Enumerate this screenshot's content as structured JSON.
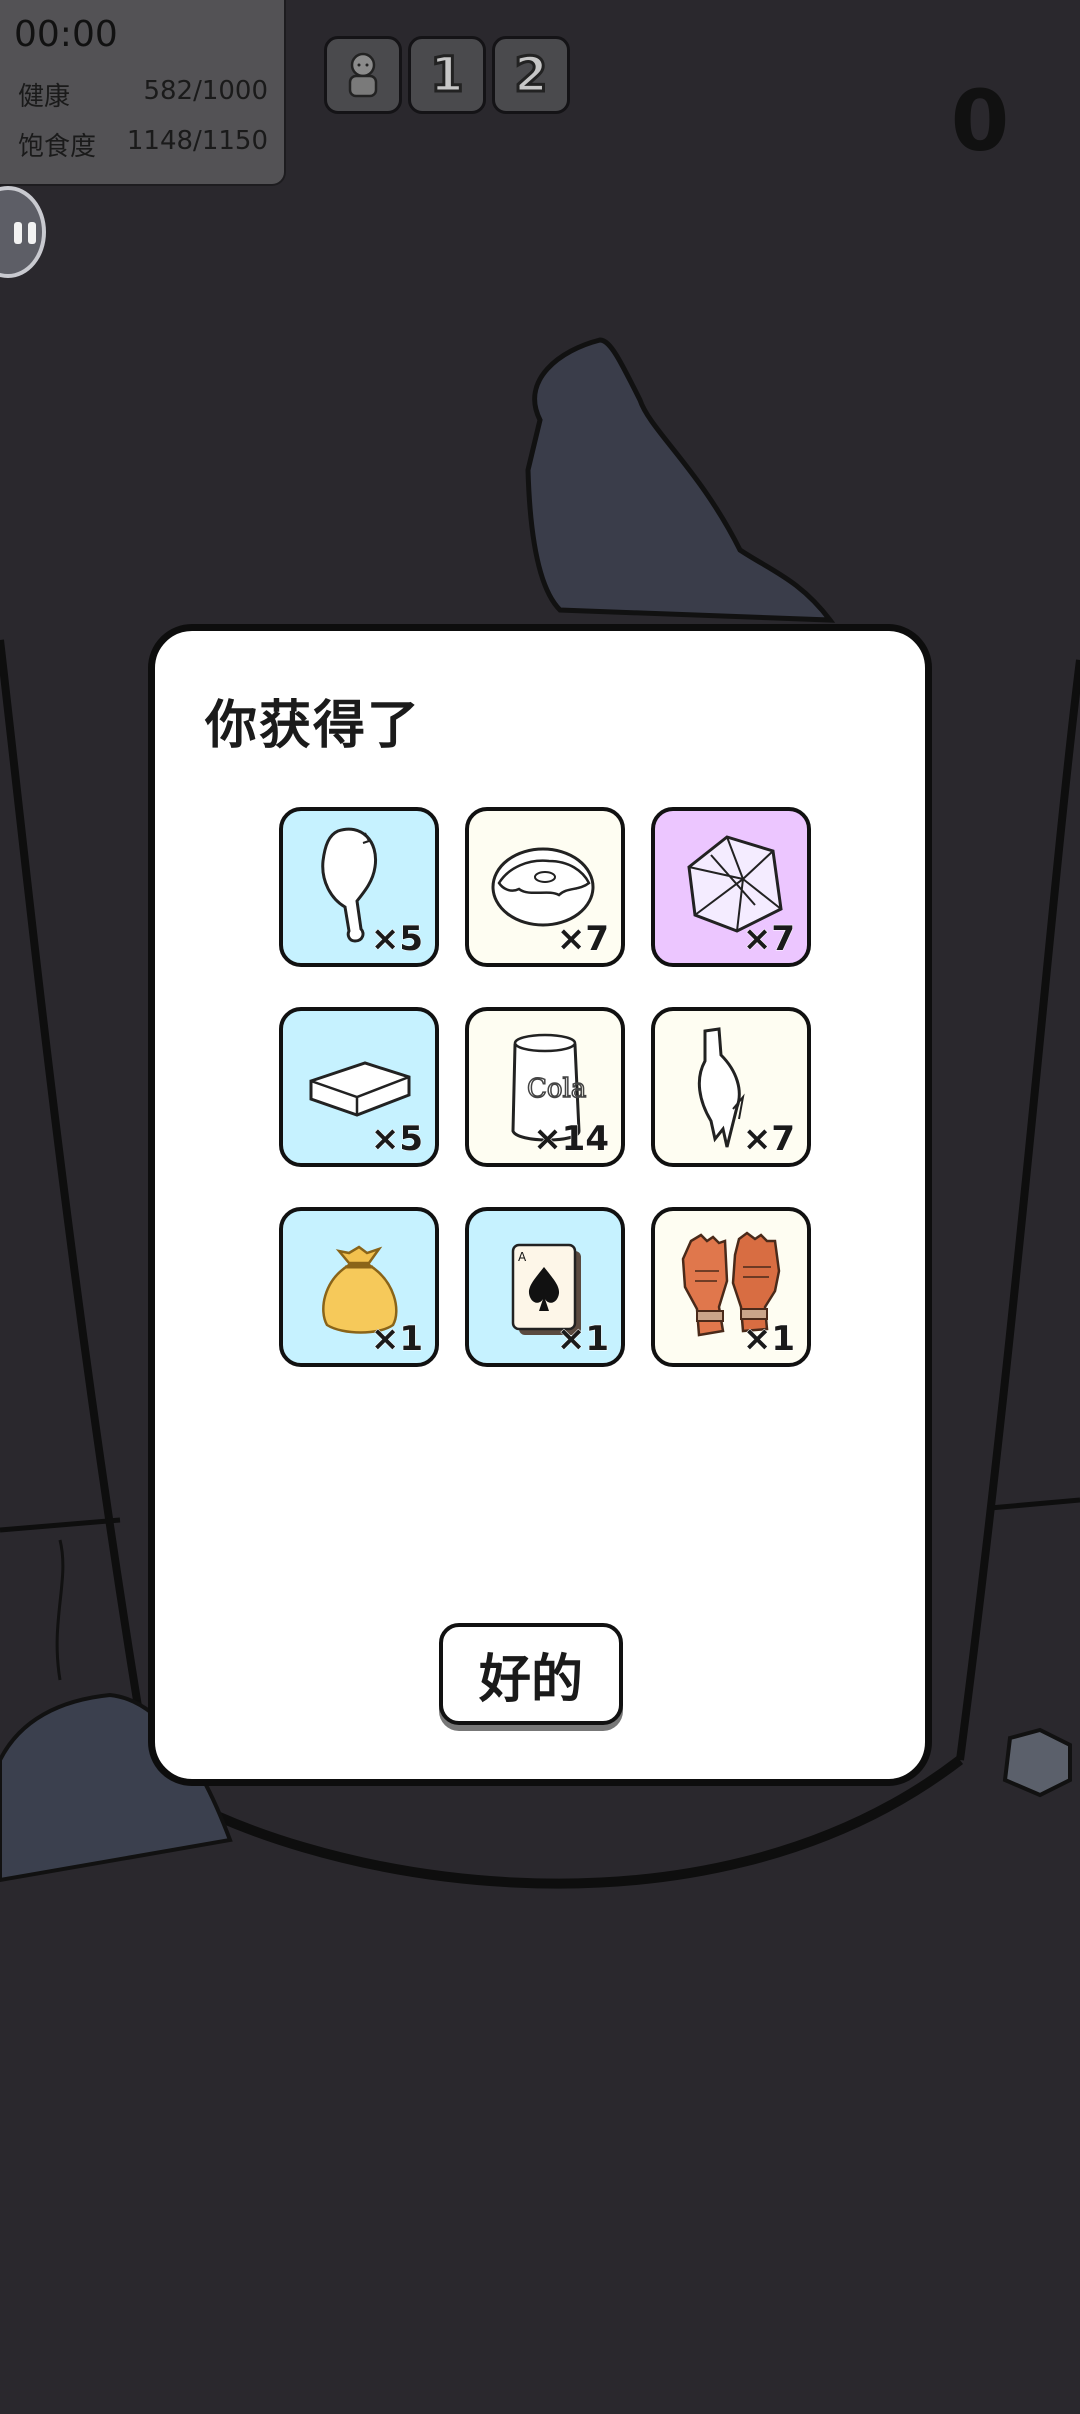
{
  "hud": {
    "timer": "00:00",
    "health_label": "健康",
    "health_value": "582/1000",
    "satiety_label": "饱食度",
    "satiety_value": "1148/1150",
    "score": "0",
    "buttons": [
      {
        "name": "character-button",
        "icon": "character-icon"
      },
      {
        "name": "slot-1-button",
        "label": "1"
      },
      {
        "name": "slot-2-button",
        "label": "2"
      }
    ]
  },
  "dialog": {
    "title": "你获得了",
    "ok_label": "好的",
    "items": [
      {
        "name": "chicken-leg",
        "icon": "chicken-leg-icon",
        "qty": "×5",
        "bg": "#c6f2ff"
      },
      {
        "name": "donut",
        "icon": "donut-icon",
        "qty": "×7",
        "bg": "#fefdf2"
      },
      {
        "name": "crystal",
        "icon": "crystal-icon",
        "qty": "×7",
        "bg": "#ecc6ff"
      },
      {
        "name": "silver-bar",
        "icon": "ingot-icon",
        "qty": "×5",
        "bg": "#c6f2ff"
      },
      {
        "name": "cola-can",
        "icon": "can-icon",
        "qty": "×14",
        "bg": "#fefdf2"
      },
      {
        "name": "broken-bottle",
        "icon": "bottle-icon",
        "qty": "×7",
        "bg": "#fefdf2"
      },
      {
        "name": "gold-sack",
        "icon": "sack-icon",
        "qty": "×1",
        "bg": "#c6f2ff"
      },
      {
        "name": "ace-of-spades",
        "icon": "playing-card-icon",
        "qty": "×1",
        "bg": "#c6f2ff"
      },
      {
        "name": "gloves",
        "icon": "gloves-icon",
        "qty": "×1",
        "bg": "#fefdf2"
      }
    ]
  },
  "colors": {
    "backdrop": "#2a282d",
    "rare_item_bg": "#c6f2ff",
    "common_item_bg": "#fefdf2",
    "epic_item_bg": "#ecc6ff"
  }
}
